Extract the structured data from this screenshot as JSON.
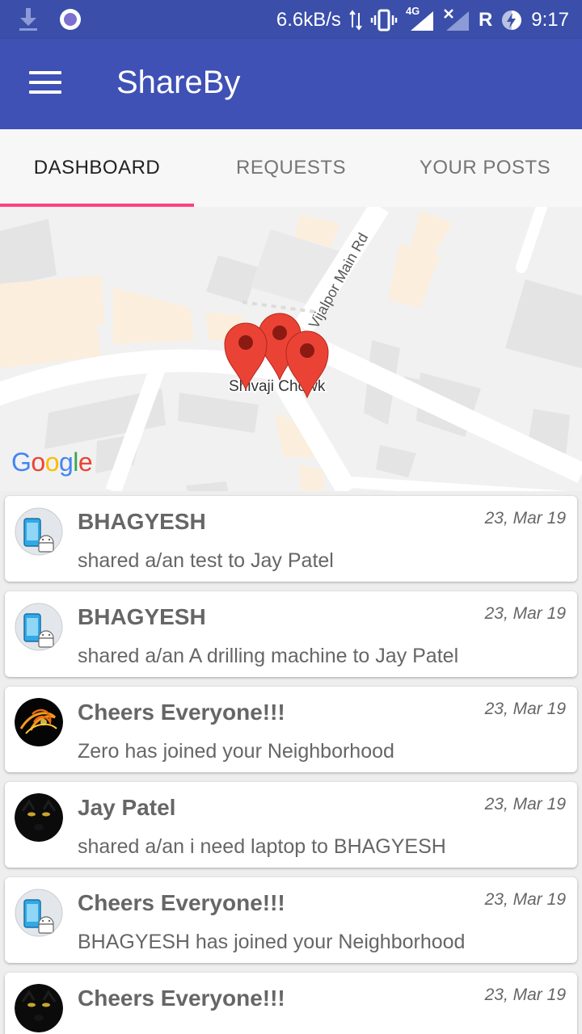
{
  "status_bar": {
    "speed": "6.6kB/s",
    "network": "4G",
    "roaming": "R",
    "time": "9:17"
  },
  "app_bar": {
    "title": "ShareBy"
  },
  "tabs": [
    {
      "label": "DASHBOARD",
      "active": true
    },
    {
      "label": "REQUESTS",
      "active": false
    },
    {
      "label": "YOUR POSTS",
      "active": false
    }
  ],
  "map": {
    "road_label": "Vijalpor Main Rd",
    "place_label": "Shivaji Chowk",
    "logo_text": "Google"
  },
  "feed": [
    {
      "title": "BHAGYESH",
      "date": "23, Mar 19",
      "message": "shared a/an test to Jay Patel",
      "avatar": "phone-android"
    },
    {
      "title": "BHAGYESH",
      "date": "23, Mar 19",
      "message": "shared a/an A drilling machine to Jay Patel",
      "avatar": "phone-android"
    },
    {
      "title": "Cheers Everyone!!!",
      "date": "23, Mar 19",
      "message": "Zero has joined your Neighborhood",
      "avatar": "fire-swirl"
    },
    {
      "title": "Jay Patel",
      "date": "23, Mar 19",
      "message": "shared a/an i need laptop to BHAGYESH",
      "avatar": "black-panther"
    },
    {
      "title": "Cheers Everyone!!!",
      "date": "23, Mar 19",
      "message": "BHAGYESH has joined your Neighborhood",
      "avatar": "phone-android"
    },
    {
      "title": "Cheers Everyone!!!",
      "date": "23, Mar 19",
      "message": "",
      "avatar": "black-panther"
    }
  ]
}
